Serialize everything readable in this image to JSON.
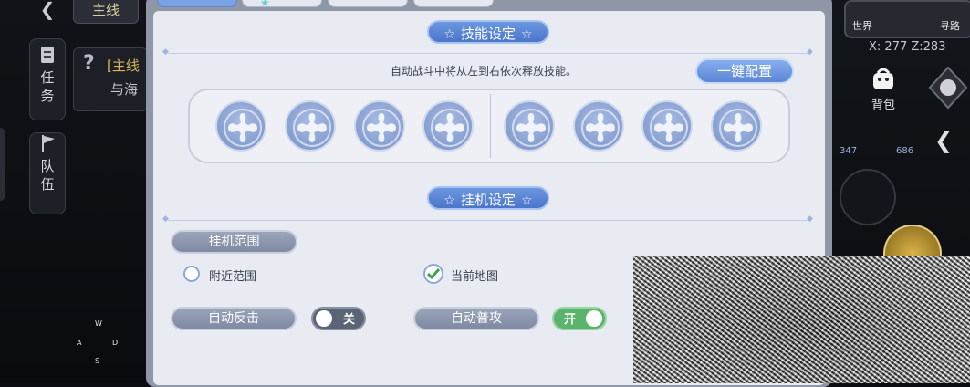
{
  "left_hud": {
    "main_tab": "主线",
    "side_task": [
      "任",
      "务"
    ],
    "side_team": [
      "队",
      "伍"
    ],
    "quest_title": "[主线",
    "quest_desc": "与海",
    "wasd": [
      "W",
      "A",
      "D",
      "S"
    ]
  },
  "dialog": {
    "skill_section_title": "技能设定",
    "hint": "自动战斗中将从左到右依次释放技能。",
    "onekey_label": "一键配置",
    "afk_section_title": "挂机设定",
    "afk_range_label": "挂机范围",
    "option_nearby": "附近范围",
    "option_current_map": "当前地图",
    "auto_counter_label": "自动反击",
    "auto_counter_toggle": "关",
    "auto_attack_label": "自动普攻",
    "auto_attack_toggle": "开",
    "skill_slots": 8,
    "selected_range": "当前地图"
  },
  "right_hud": {
    "world_label": "世界",
    "way_label": "寻路",
    "coords": "X: 277  Z:283",
    "bag_label": "背包",
    "count_a": "347",
    "count_b": "686"
  },
  "colors": {
    "accent": "#4b75c9",
    "toggle_on": "#5ab46b",
    "toggle_off": "#5b6475"
  }
}
